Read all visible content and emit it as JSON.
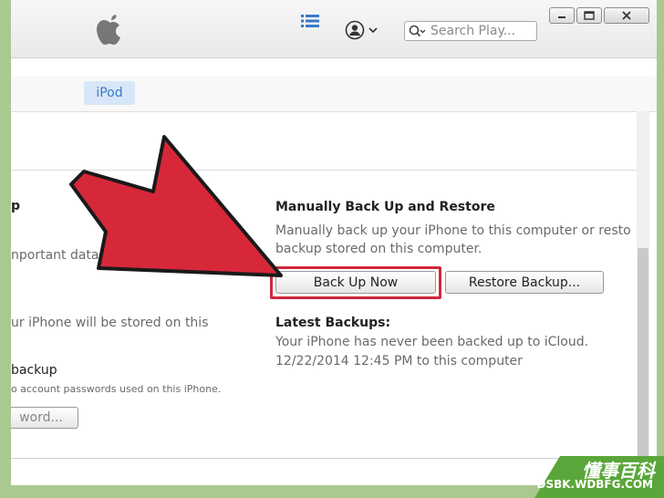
{
  "toolbar": {
    "search_placeholder": "Search Play..."
  },
  "device": {
    "tab_label": "iPod"
  },
  "left_partial": {
    "heading_fragment": "p",
    "important_data": "nportant data",
    "stored_on_this": "ur iPhone will be stored on this",
    "backup_heading": "backup",
    "account_passwords": "o account passwords used on this iPhone.",
    "password_button": "word..."
  },
  "manual": {
    "title": "Manually Back Up and Restore",
    "desc_line1": "Manually back up your iPhone to this computer or resto",
    "desc_line2": "backup stored on this computer.",
    "back_up_now_label": "Back Up Now",
    "restore_backup_label": "Restore Backup..."
  },
  "latest": {
    "title": "Latest Backups:",
    "line1": "Your iPhone has never been backed up to iCloud.",
    "line2": "12/22/2014 12:45 PM to this computer"
  },
  "watermark": {
    "chinese": "懂事百科",
    "url": "DSBK.WDBFG.COM"
  },
  "colors": {
    "arrow_red": "#d7283a",
    "accent_blue": "#3a78c8",
    "watermark_green": "#5aa63a"
  }
}
